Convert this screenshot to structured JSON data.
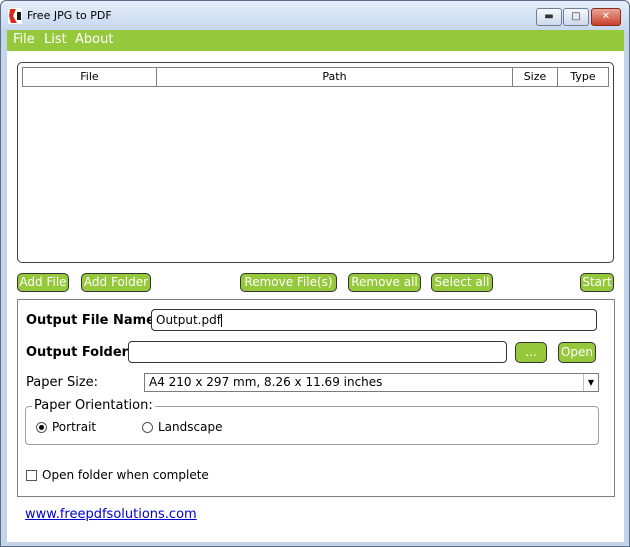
{
  "window": {
    "title": "Free JPG to PDF",
    "minimize_glyph": "▬",
    "maximize_glyph": "□",
    "close_glyph": "✕"
  },
  "menu": {
    "items": [
      "File",
      "List",
      "About"
    ]
  },
  "file_list": {
    "columns": [
      "File",
      "Path",
      "Size",
      "Type"
    ],
    "rows": []
  },
  "actions": {
    "add_file": "Add File",
    "add_folder": "Add Folder",
    "remove_files": "Remove File(s)",
    "remove_all": "Remove all",
    "select_all": "Select all",
    "start": "Start"
  },
  "options": {
    "output_file_label": "Output File Name:",
    "output_file_value": "Output.pdf",
    "output_folder_label": "Output Folder:",
    "output_folder_value": "",
    "browse_label": "...",
    "open_label": "Open",
    "paper_size_label": "Paper Size:",
    "paper_size_value": "A4 210 x 297 mm, 8.26 x 11.69 inches",
    "orientation_label": "Paper Orientation:",
    "orientation_portrait": "Portrait",
    "orientation_landscape": "Landscape",
    "orientation_selected": "Portrait",
    "open_when_complete_label": "Open folder when complete",
    "open_when_complete_checked": false
  },
  "footer": {
    "link_text": "www.freepdfsolutions.com"
  },
  "colors": {
    "accent_green": "#95c93b",
    "link_blue": "#0000cc"
  }
}
